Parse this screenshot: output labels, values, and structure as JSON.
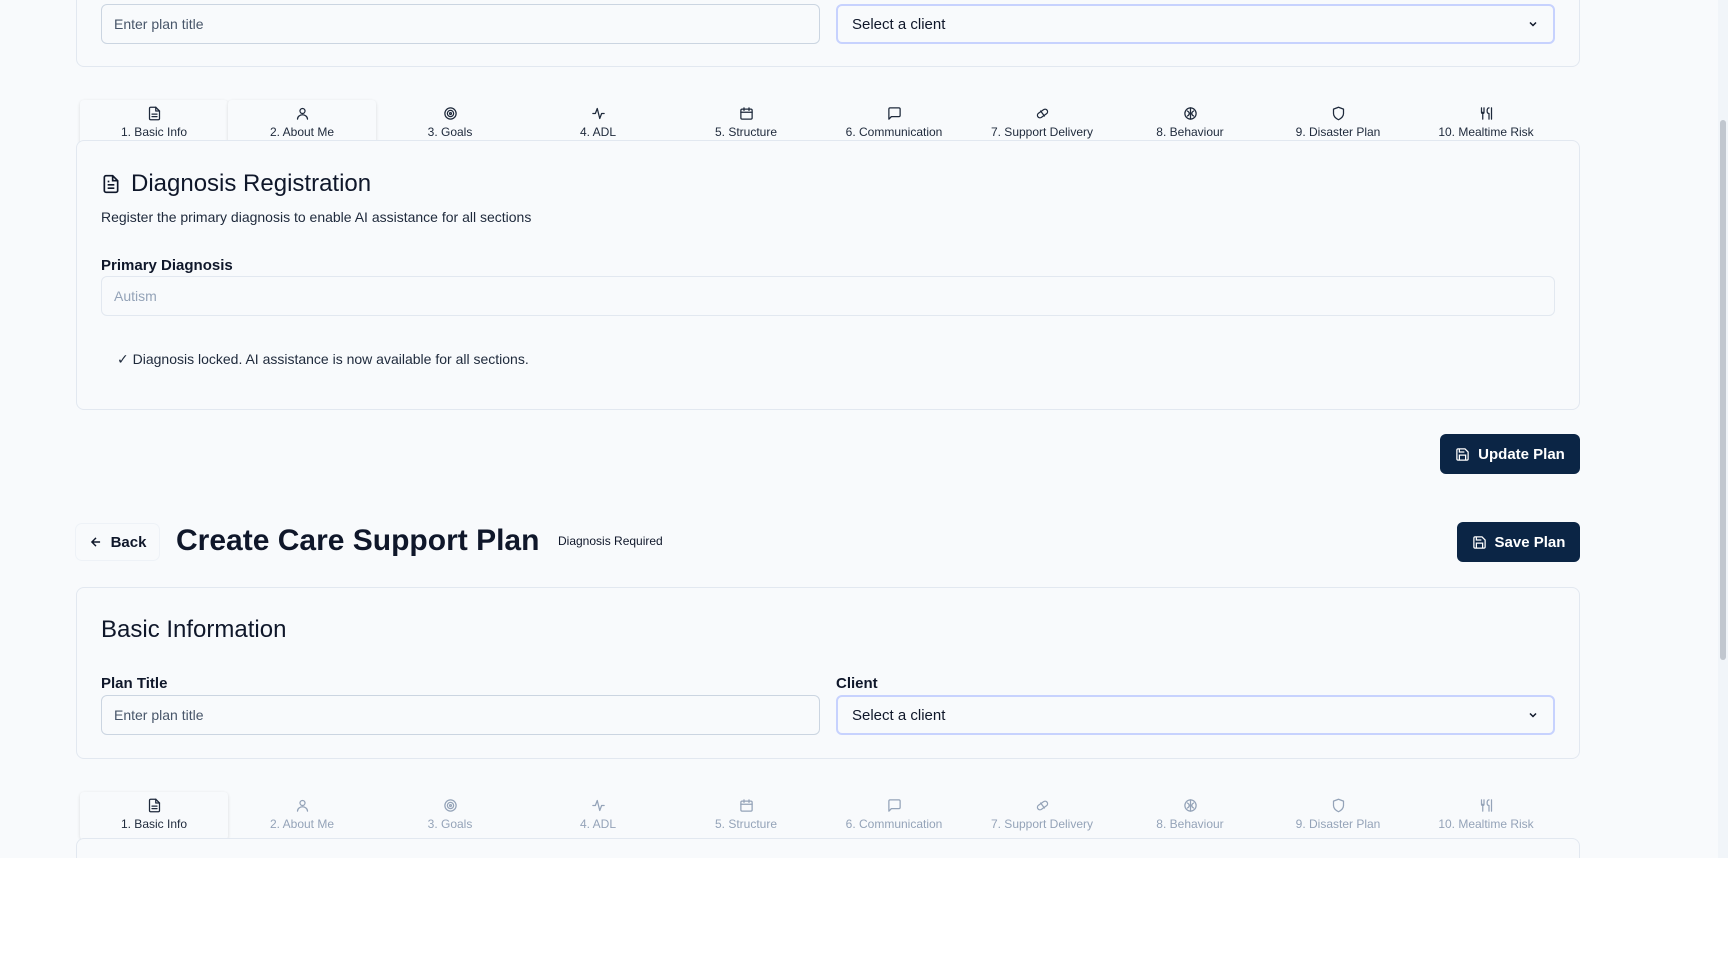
{
  "top_form": {
    "plan_title_placeholder": "Enter plan title",
    "client_select_value": "Select a client"
  },
  "tabs": [
    {
      "label": "1. Basic Info",
      "icon": "file-text-icon"
    },
    {
      "label": "2. About Me",
      "icon": "user-icon"
    },
    {
      "label": "3. Goals",
      "icon": "target-icon"
    },
    {
      "label": "4. ADL",
      "icon": "activity-icon"
    },
    {
      "label": "5. Structure",
      "icon": "calendar-icon"
    },
    {
      "label": "6. Communication",
      "icon": "message-icon"
    },
    {
      "label": "7. Support Delivery",
      "icon": "pill-icon"
    },
    {
      "label": "8. Behaviour",
      "icon": "brain-icon"
    },
    {
      "label": "9. Disaster Plan",
      "icon": "shield-icon"
    },
    {
      "label": "10. Mealtime Risk",
      "icon": "utensils-icon"
    }
  ],
  "diagnosis": {
    "title": "Diagnosis Registration",
    "description": "Register the primary diagnosis to enable AI assistance for all sections",
    "field_label": "Primary Diagnosis",
    "field_value": "Autism",
    "locked_message": "✓ Diagnosis locked. AI assistance is now available for all sections."
  },
  "update_button_label": "Update Plan",
  "header": {
    "back_label": "Back",
    "page_title": "Create Care Support Plan",
    "status_text": "Diagnosis Required",
    "save_button_label": "Save Plan"
  },
  "basic_info": {
    "title": "Basic Information",
    "plan_title_label": "Plan Title",
    "plan_title_placeholder": "Enter plan title",
    "client_label": "Client",
    "client_select_value": "Select a client"
  },
  "colors": {
    "primary": "#0b2545",
    "background": "#f8fafc",
    "border": "#e2e8f0"
  }
}
